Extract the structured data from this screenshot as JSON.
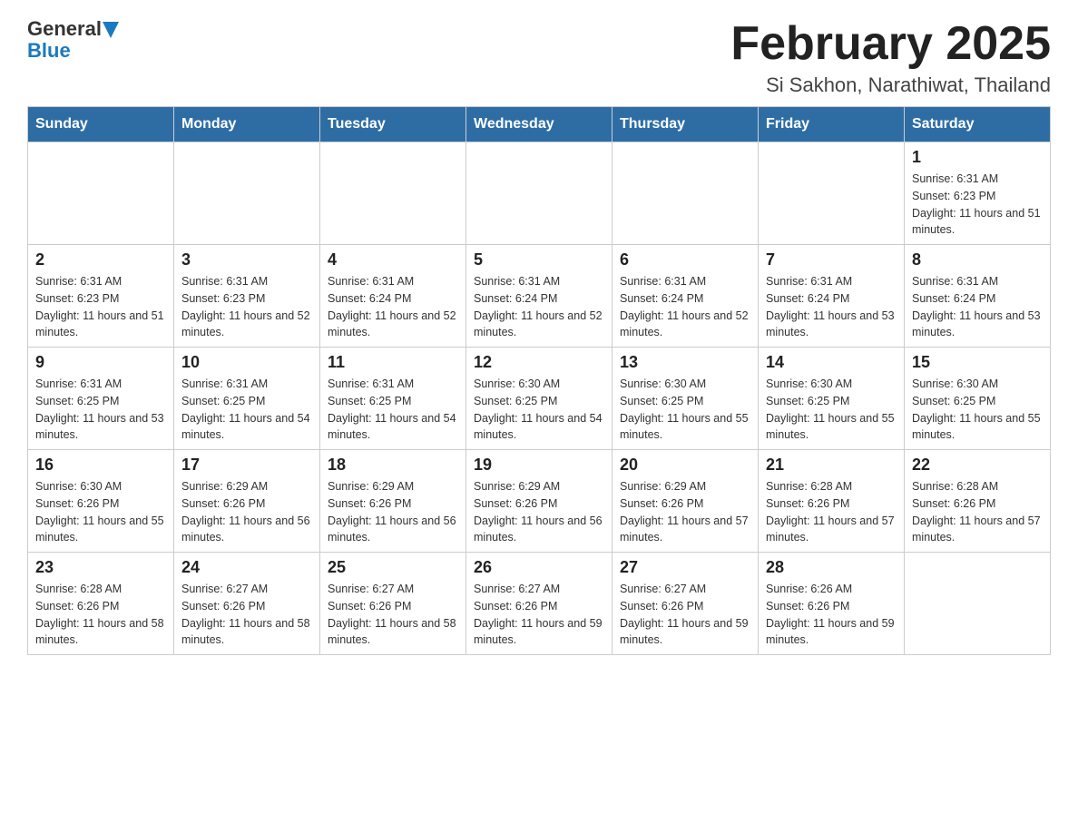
{
  "header": {
    "logo_general": "General",
    "logo_blue": "Blue",
    "month_title": "February 2025",
    "location": "Si Sakhon, Narathiwat, Thailand"
  },
  "weekdays": [
    "Sunday",
    "Monday",
    "Tuesday",
    "Wednesday",
    "Thursday",
    "Friday",
    "Saturday"
  ],
  "weeks": [
    [
      {
        "day": "",
        "info": ""
      },
      {
        "day": "",
        "info": ""
      },
      {
        "day": "",
        "info": ""
      },
      {
        "day": "",
        "info": ""
      },
      {
        "day": "",
        "info": ""
      },
      {
        "day": "",
        "info": ""
      },
      {
        "day": "1",
        "info": "Sunrise: 6:31 AM\nSunset: 6:23 PM\nDaylight: 11 hours and 51 minutes."
      }
    ],
    [
      {
        "day": "2",
        "info": "Sunrise: 6:31 AM\nSunset: 6:23 PM\nDaylight: 11 hours and 51 minutes."
      },
      {
        "day": "3",
        "info": "Sunrise: 6:31 AM\nSunset: 6:23 PM\nDaylight: 11 hours and 52 minutes."
      },
      {
        "day": "4",
        "info": "Sunrise: 6:31 AM\nSunset: 6:24 PM\nDaylight: 11 hours and 52 minutes."
      },
      {
        "day": "5",
        "info": "Sunrise: 6:31 AM\nSunset: 6:24 PM\nDaylight: 11 hours and 52 minutes."
      },
      {
        "day": "6",
        "info": "Sunrise: 6:31 AM\nSunset: 6:24 PM\nDaylight: 11 hours and 52 minutes."
      },
      {
        "day": "7",
        "info": "Sunrise: 6:31 AM\nSunset: 6:24 PM\nDaylight: 11 hours and 53 minutes."
      },
      {
        "day": "8",
        "info": "Sunrise: 6:31 AM\nSunset: 6:24 PM\nDaylight: 11 hours and 53 minutes."
      }
    ],
    [
      {
        "day": "9",
        "info": "Sunrise: 6:31 AM\nSunset: 6:25 PM\nDaylight: 11 hours and 53 minutes."
      },
      {
        "day": "10",
        "info": "Sunrise: 6:31 AM\nSunset: 6:25 PM\nDaylight: 11 hours and 54 minutes."
      },
      {
        "day": "11",
        "info": "Sunrise: 6:31 AM\nSunset: 6:25 PM\nDaylight: 11 hours and 54 minutes."
      },
      {
        "day": "12",
        "info": "Sunrise: 6:30 AM\nSunset: 6:25 PM\nDaylight: 11 hours and 54 minutes."
      },
      {
        "day": "13",
        "info": "Sunrise: 6:30 AM\nSunset: 6:25 PM\nDaylight: 11 hours and 55 minutes."
      },
      {
        "day": "14",
        "info": "Sunrise: 6:30 AM\nSunset: 6:25 PM\nDaylight: 11 hours and 55 minutes."
      },
      {
        "day": "15",
        "info": "Sunrise: 6:30 AM\nSunset: 6:25 PM\nDaylight: 11 hours and 55 minutes."
      }
    ],
    [
      {
        "day": "16",
        "info": "Sunrise: 6:30 AM\nSunset: 6:26 PM\nDaylight: 11 hours and 55 minutes."
      },
      {
        "day": "17",
        "info": "Sunrise: 6:29 AM\nSunset: 6:26 PM\nDaylight: 11 hours and 56 minutes."
      },
      {
        "day": "18",
        "info": "Sunrise: 6:29 AM\nSunset: 6:26 PM\nDaylight: 11 hours and 56 minutes."
      },
      {
        "day": "19",
        "info": "Sunrise: 6:29 AM\nSunset: 6:26 PM\nDaylight: 11 hours and 56 minutes."
      },
      {
        "day": "20",
        "info": "Sunrise: 6:29 AM\nSunset: 6:26 PM\nDaylight: 11 hours and 57 minutes."
      },
      {
        "day": "21",
        "info": "Sunrise: 6:28 AM\nSunset: 6:26 PM\nDaylight: 11 hours and 57 minutes."
      },
      {
        "day": "22",
        "info": "Sunrise: 6:28 AM\nSunset: 6:26 PM\nDaylight: 11 hours and 57 minutes."
      }
    ],
    [
      {
        "day": "23",
        "info": "Sunrise: 6:28 AM\nSunset: 6:26 PM\nDaylight: 11 hours and 58 minutes."
      },
      {
        "day": "24",
        "info": "Sunrise: 6:27 AM\nSunset: 6:26 PM\nDaylight: 11 hours and 58 minutes."
      },
      {
        "day": "25",
        "info": "Sunrise: 6:27 AM\nSunset: 6:26 PM\nDaylight: 11 hours and 58 minutes."
      },
      {
        "day": "26",
        "info": "Sunrise: 6:27 AM\nSunset: 6:26 PM\nDaylight: 11 hours and 59 minutes."
      },
      {
        "day": "27",
        "info": "Sunrise: 6:27 AM\nSunset: 6:26 PM\nDaylight: 11 hours and 59 minutes."
      },
      {
        "day": "28",
        "info": "Sunrise: 6:26 AM\nSunset: 6:26 PM\nDaylight: 11 hours and 59 minutes."
      },
      {
        "day": "",
        "info": ""
      }
    ]
  ]
}
